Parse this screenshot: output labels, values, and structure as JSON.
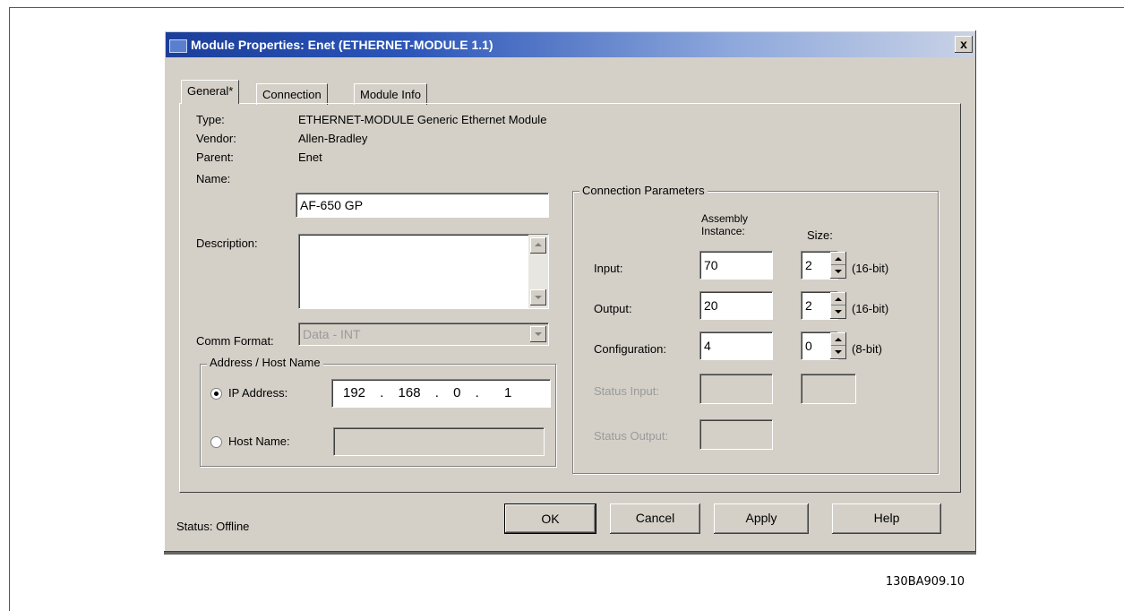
{
  "dialog": {
    "title": "Module Properties: Enet (ETHERNET-MODULE 1.1)",
    "close_glyph": "x",
    "tabs": [
      {
        "label": "General*",
        "active": true
      },
      {
        "label": "Connection",
        "active": false
      },
      {
        "label": "Module Info",
        "active": false
      }
    ]
  },
  "general": {
    "type_label": "Type:",
    "type_value": "ETHERNET-MODULE Generic Ethernet Module",
    "vendor_label": "Vendor:",
    "vendor_value": "Allen-Bradley",
    "parent_label": "Parent:",
    "parent_value": "Enet",
    "name_label": "Name:",
    "name_value": "AF-650 GP",
    "description_label": "Description:",
    "description_value": "",
    "comm_format_label": "Comm Format:",
    "comm_format_value": "Data - INT"
  },
  "address": {
    "group_title": "Address / Host Name",
    "ip_label": "IP Address:",
    "ip_octets": [
      "192",
      "168",
      "0",
      "1"
    ],
    "ip_selected": true,
    "host_label": "Host Name:",
    "host_value": ""
  },
  "connection_params": {
    "group_title": "Connection Parameters",
    "assembly_header": "Assembly Instance:",
    "size_header": "Size:",
    "rows": [
      {
        "label": "Input:",
        "instance": "70",
        "size": "2",
        "unit": "(16-bit)",
        "enabled": true
      },
      {
        "label": "Output:",
        "instance": "20",
        "size": "2",
        "unit": "(16-bit)",
        "enabled": true
      },
      {
        "label": "Configuration:",
        "instance": "4",
        "size": "0",
        "unit": "(8-bit)",
        "enabled": true
      },
      {
        "label": "Status Input:",
        "instance": "",
        "size": "",
        "unit": "",
        "enabled": false
      },
      {
        "label": "Status Output:",
        "instance": "",
        "size": "",
        "unit": "",
        "enabled": false
      }
    ]
  },
  "footer": {
    "status_text": "Status:  Offline",
    "ok_label": "OK",
    "cancel_label": "Cancel",
    "apply_label": "Apply",
    "help_label": "Help"
  },
  "figure_code": "130BA909.10",
  "colors": {
    "title_start": "#1b3e9a",
    "title_end": "#c9d2e6",
    "window_face": "#d4d0c8"
  }
}
